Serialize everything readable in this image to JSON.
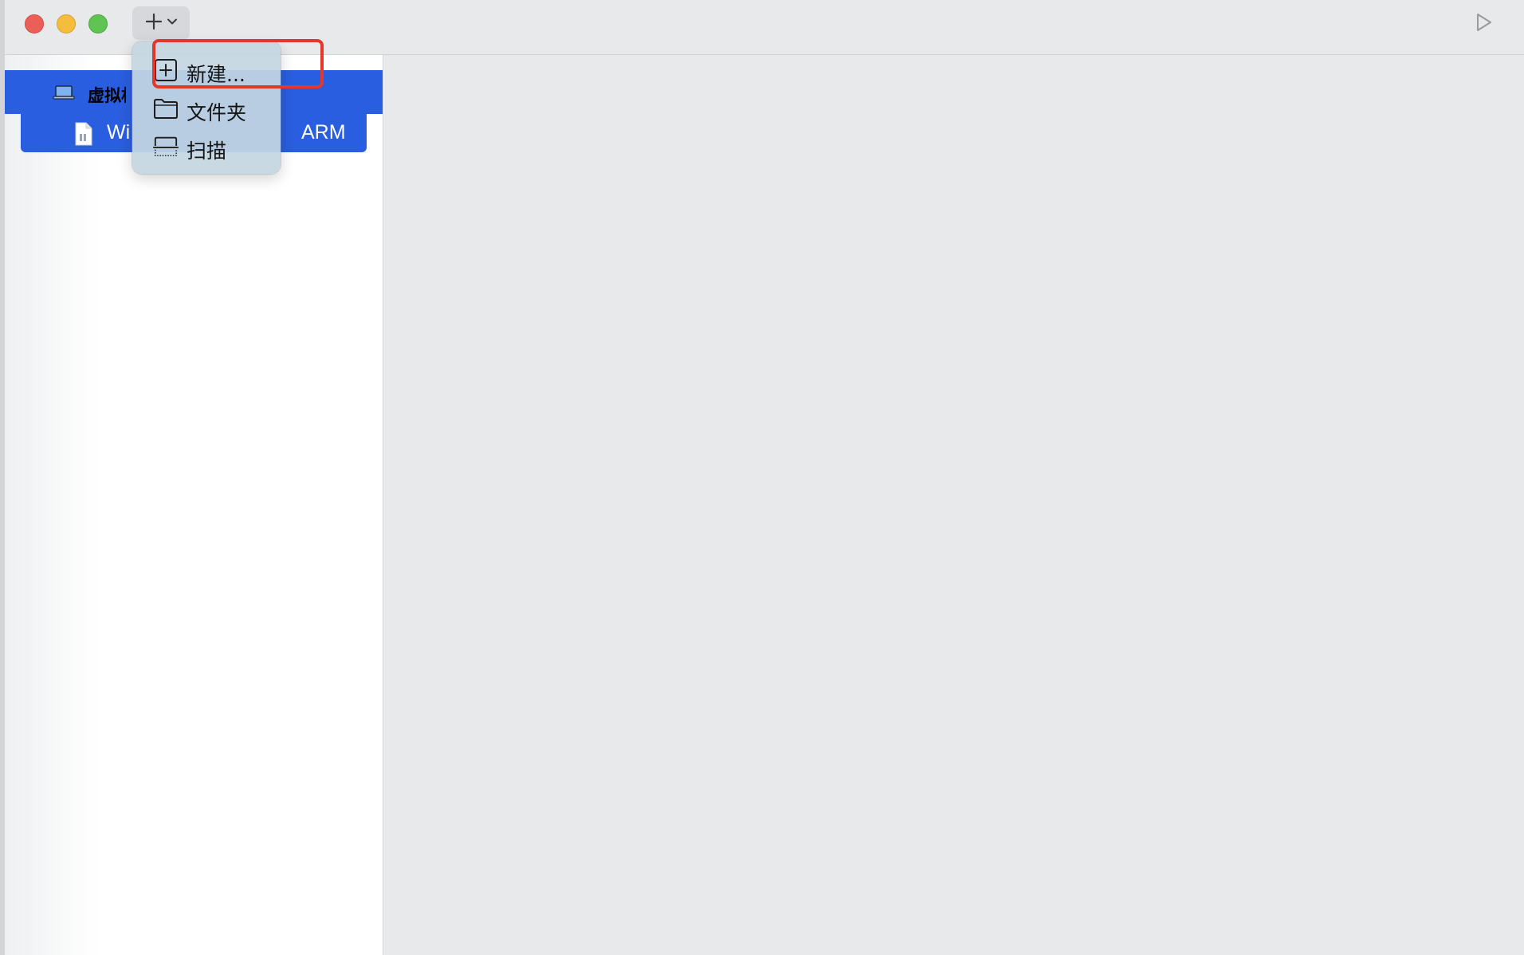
{
  "toolbar": {
    "add_icon": "plus-icon",
    "dropdown_icon": "chevron-down-icon",
    "run_icon": "play-icon"
  },
  "sidebar": {
    "section_label": "虚拟机",
    "vm_name_start": "Wi",
    "vm_name_end": "ARM"
  },
  "menu": {
    "items": [
      {
        "label": "新建...",
        "icon": "new-plus-square-icon"
      },
      {
        "label": "文件夹",
        "icon": "folder-icon"
      },
      {
        "label": "扫描",
        "icon": "scan-icon"
      }
    ]
  },
  "colors": {
    "selection_blue": "#2a5ee0",
    "highlight_red": "#e2372b",
    "close": "#ec5f58",
    "minimize": "#f4be3c",
    "zoom": "#5fc453"
  }
}
